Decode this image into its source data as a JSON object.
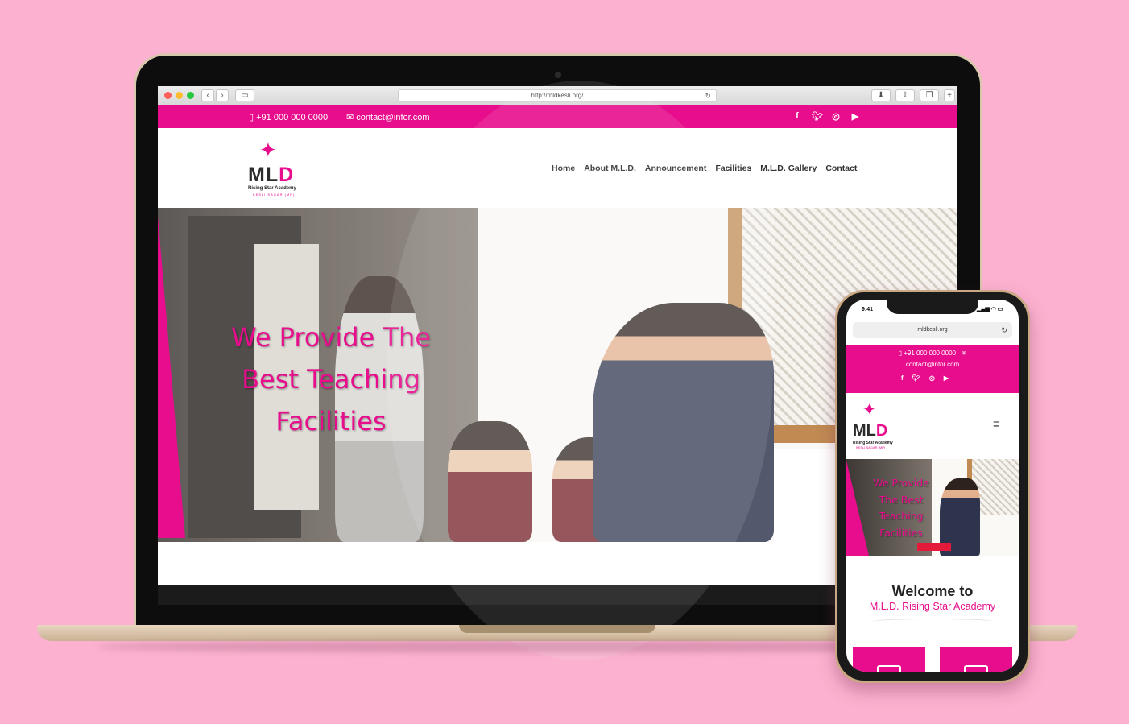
{
  "browser": {
    "url": "http://mldkesli.org/",
    "reload_icon": "↻"
  },
  "site": {
    "phone": "+91 000 000 0000",
    "email": "contact@infor.com",
    "social_icons": [
      "facebook-icon",
      "twitter-icon",
      "instagram-icon",
      "youtube-icon"
    ],
    "logo": {
      "mark": "MLD",
      "title": "Rising Star Academy",
      "location": "KESLI SAGAR (MP)"
    },
    "nav": [
      "Home",
      "About M.L.D.",
      "Announcement",
      "Facilities",
      "M.L.D. Gallery",
      "Contact"
    ],
    "hero_title": "We Provide The Best Teaching Facilities",
    "accent_color": "#e70d8c"
  },
  "mobile": {
    "time": "9:41",
    "url": "mldkesli.org",
    "phone": "+91 000 000 0000",
    "email": "contact@infor.com",
    "hero_title": "We Provide The Best Teaching Facilities",
    "welcome": "Welcome to",
    "academy": "M.L.D. Rising Star Academy",
    "menu_icon": "≡"
  }
}
